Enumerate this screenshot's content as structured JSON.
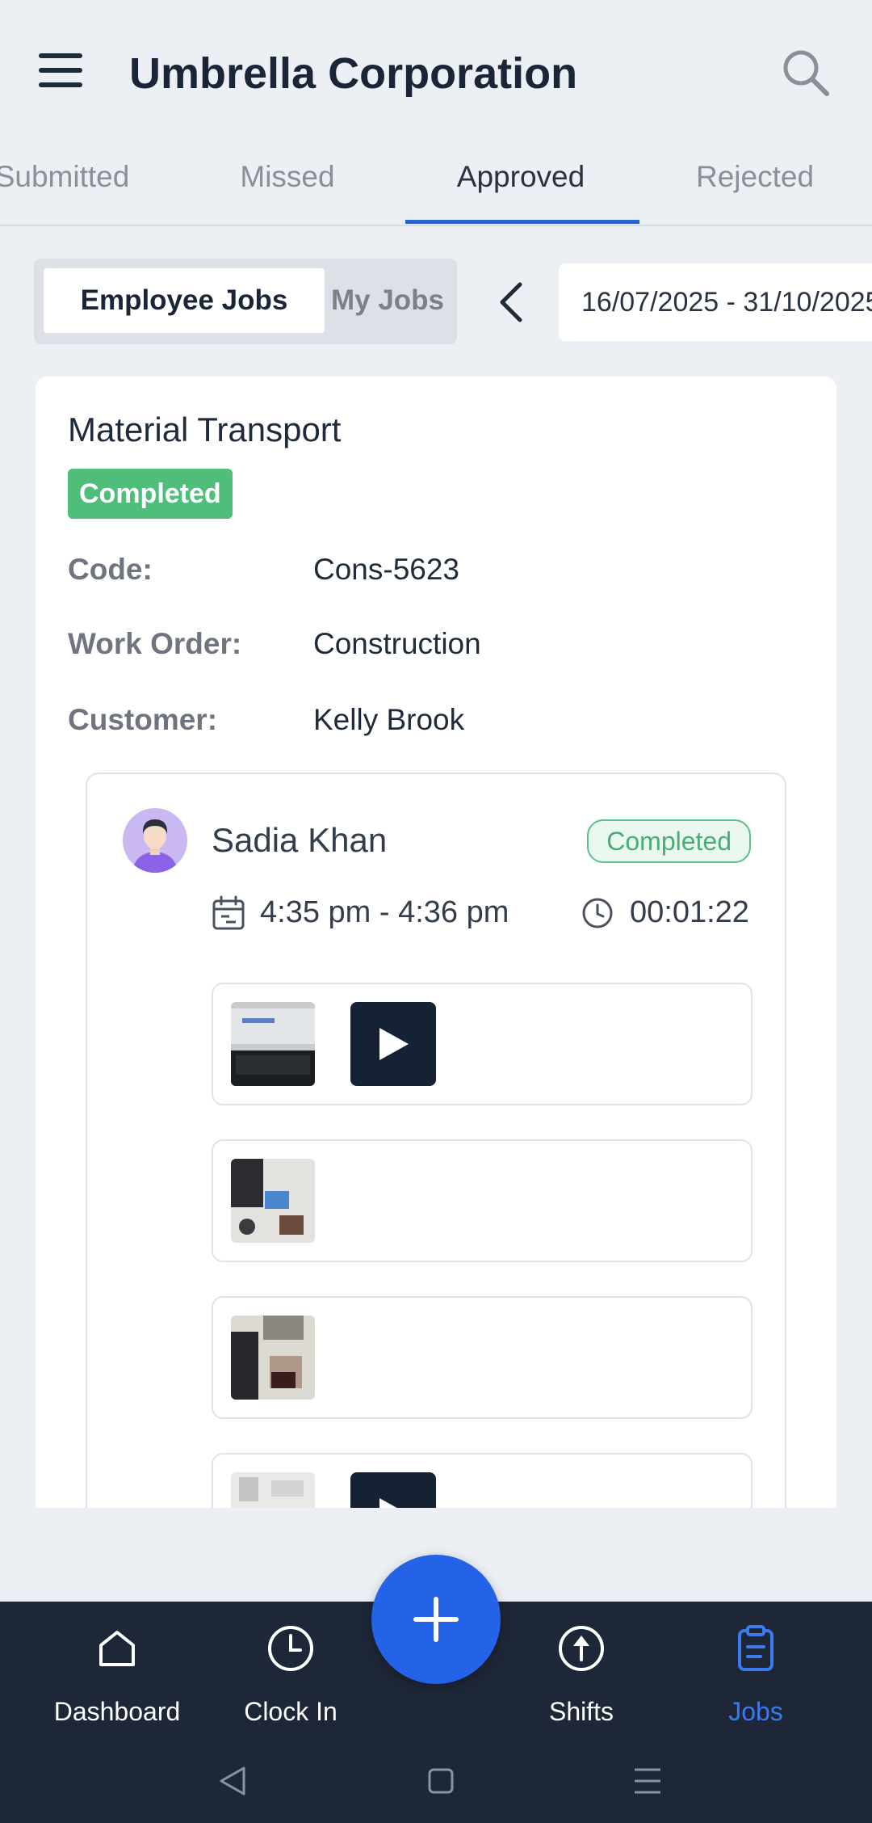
{
  "header": {
    "title": "Umbrella Corporation"
  },
  "tabs": [
    {
      "label": "Submitted",
      "active": false
    },
    {
      "label": "Missed",
      "active": false
    },
    {
      "label": "Approved",
      "active": true
    },
    {
      "label": "Rejected",
      "active": false
    }
  ],
  "toggle": {
    "employee_jobs": "Employee Jobs",
    "my_jobs": "My Jobs",
    "selected": "Employee Jobs"
  },
  "date_range": "16/07/2025 - 31/10/2025",
  "job": {
    "title": "Material Transport",
    "status": "Completed",
    "fields": {
      "code_label": "Code:",
      "code_value": "Cons-5623",
      "work_order_label": "Work Order:",
      "work_order_value": "Construction",
      "customer_label": "Customer:",
      "customer_value": "Kelly Brook"
    },
    "employee": {
      "name": "Sadia Khan",
      "status": "Completed",
      "time_range": "4:35 pm - 4:36 pm",
      "duration": "00:01:22"
    },
    "media": [
      {
        "has_video": true
      },
      {
        "has_video": false
      },
      {
        "has_video": false
      },
      {
        "has_video": true
      }
    ]
  },
  "bottom_nav": [
    {
      "label": "Dashboard",
      "icon": "home-icon",
      "active": false
    },
    {
      "label": "Clock In",
      "icon": "clock-icon",
      "active": false
    },
    {
      "label": "Shifts",
      "icon": "upload-circle-icon",
      "active": false
    },
    {
      "label": "Jobs",
      "icon": "clipboard-icon",
      "active": true
    }
  ],
  "colors": {
    "accent": "#2463e8",
    "active_tab_underline": "#2c63c8",
    "success": "#4fbe7a",
    "nav_background": "#1e2737",
    "nav_active": "#3b7bf0",
    "page_background": "#eceff4"
  }
}
